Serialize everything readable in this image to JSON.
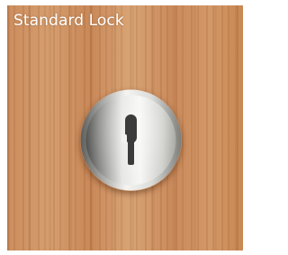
{
  "card": {
    "title": "Standard Lock"
  },
  "lock": {
    "icon": "keyhole-icon",
    "material": "brushed-steel"
  },
  "colors": {
    "wood": "#cd8f5f",
    "title_text": "#ffffff",
    "metal_light": "#f2f2f0",
    "metal_dark": "#6e6e6c",
    "keyhole": "#3b3b3b"
  }
}
